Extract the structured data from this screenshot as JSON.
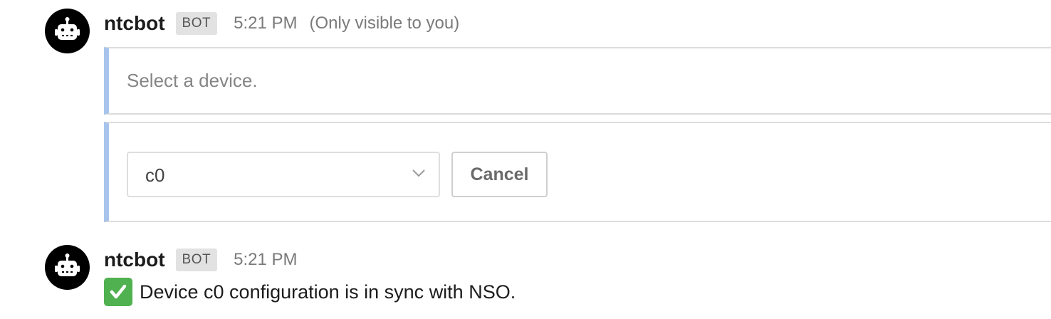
{
  "messages": [
    {
      "sender": "ntcbot",
      "badge": "BOT",
      "time": "5:21 PM",
      "ephemeral_note": "(Only visible to you)",
      "attachment_text": "Select a device.",
      "select": {
        "value": "c0"
      },
      "cancel_label": "Cancel"
    },
    {
      "sender": "ntcbot",
      "badge": "BOT",
      "time": "5:21 PM",
      "icon": "white-check-mark-emoji",
      "text": "Device c0 configuration is in sync with NSO."
    }
  ],
  "colors": {
    "attachment_bar": "#a7c4ec",
    "check_emoji": "#4fb14f"
  }
}
